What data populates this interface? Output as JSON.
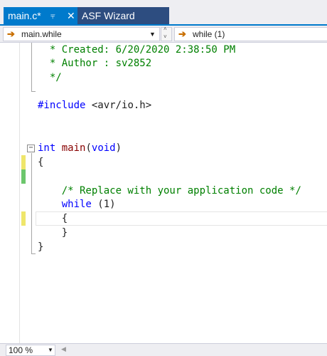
{
  "tabs": [
    {
      "label": "main.c*",
      "pin_icon": "pin-icon",
      "close_icon": "close-icon"
    },
    {
      "label": "ASF Wizard"
    }
  ],
  "nav": {
    "scope": "main.while",
    "member": "while (1)",
    "arrow_color": "#c86e00"
  },
  "code": {
    "lines": [
      "  * Created: 6/20/2020 2:38:50 PM",
      "  * Author : sv2852",
      "  */",
      "#include <avr/io.h>",
      "int main(void)",
      "{",
      "    /* Replace with your application code */",
      "    while (1)",
      "    {",
      "    }",
      "}"
    ],
    "tokens": {
      "created": "* Created: 6/20/2020 2:38:50 PM",
      "author": "* Author : sv2852",
      "comment_end": "*/",
      "include_kw": "#include",
      "include_path": " <avr/io.h>",
      "int_kw": "int",
      "main_fn": "main",
      "void_part": "(",
      "void_kw": "void",
      "paren_close": ")",
      "brace_open": "{",
      "replace_comment": "/* Replace with your application code */",
      "while_kw": "while",
      "while_cond": " (1)",
      "inner_open": "{",
      "inner_close": "}",
      "brace_close": "}"
    }
  },
  "status": {
    "zoom": "100 %"
  },
  "colors": {
    "accent": "#007acc",
    "change_saved": "#6cc66c",
    "change_unsaved": "#efe66b"
  }
}
